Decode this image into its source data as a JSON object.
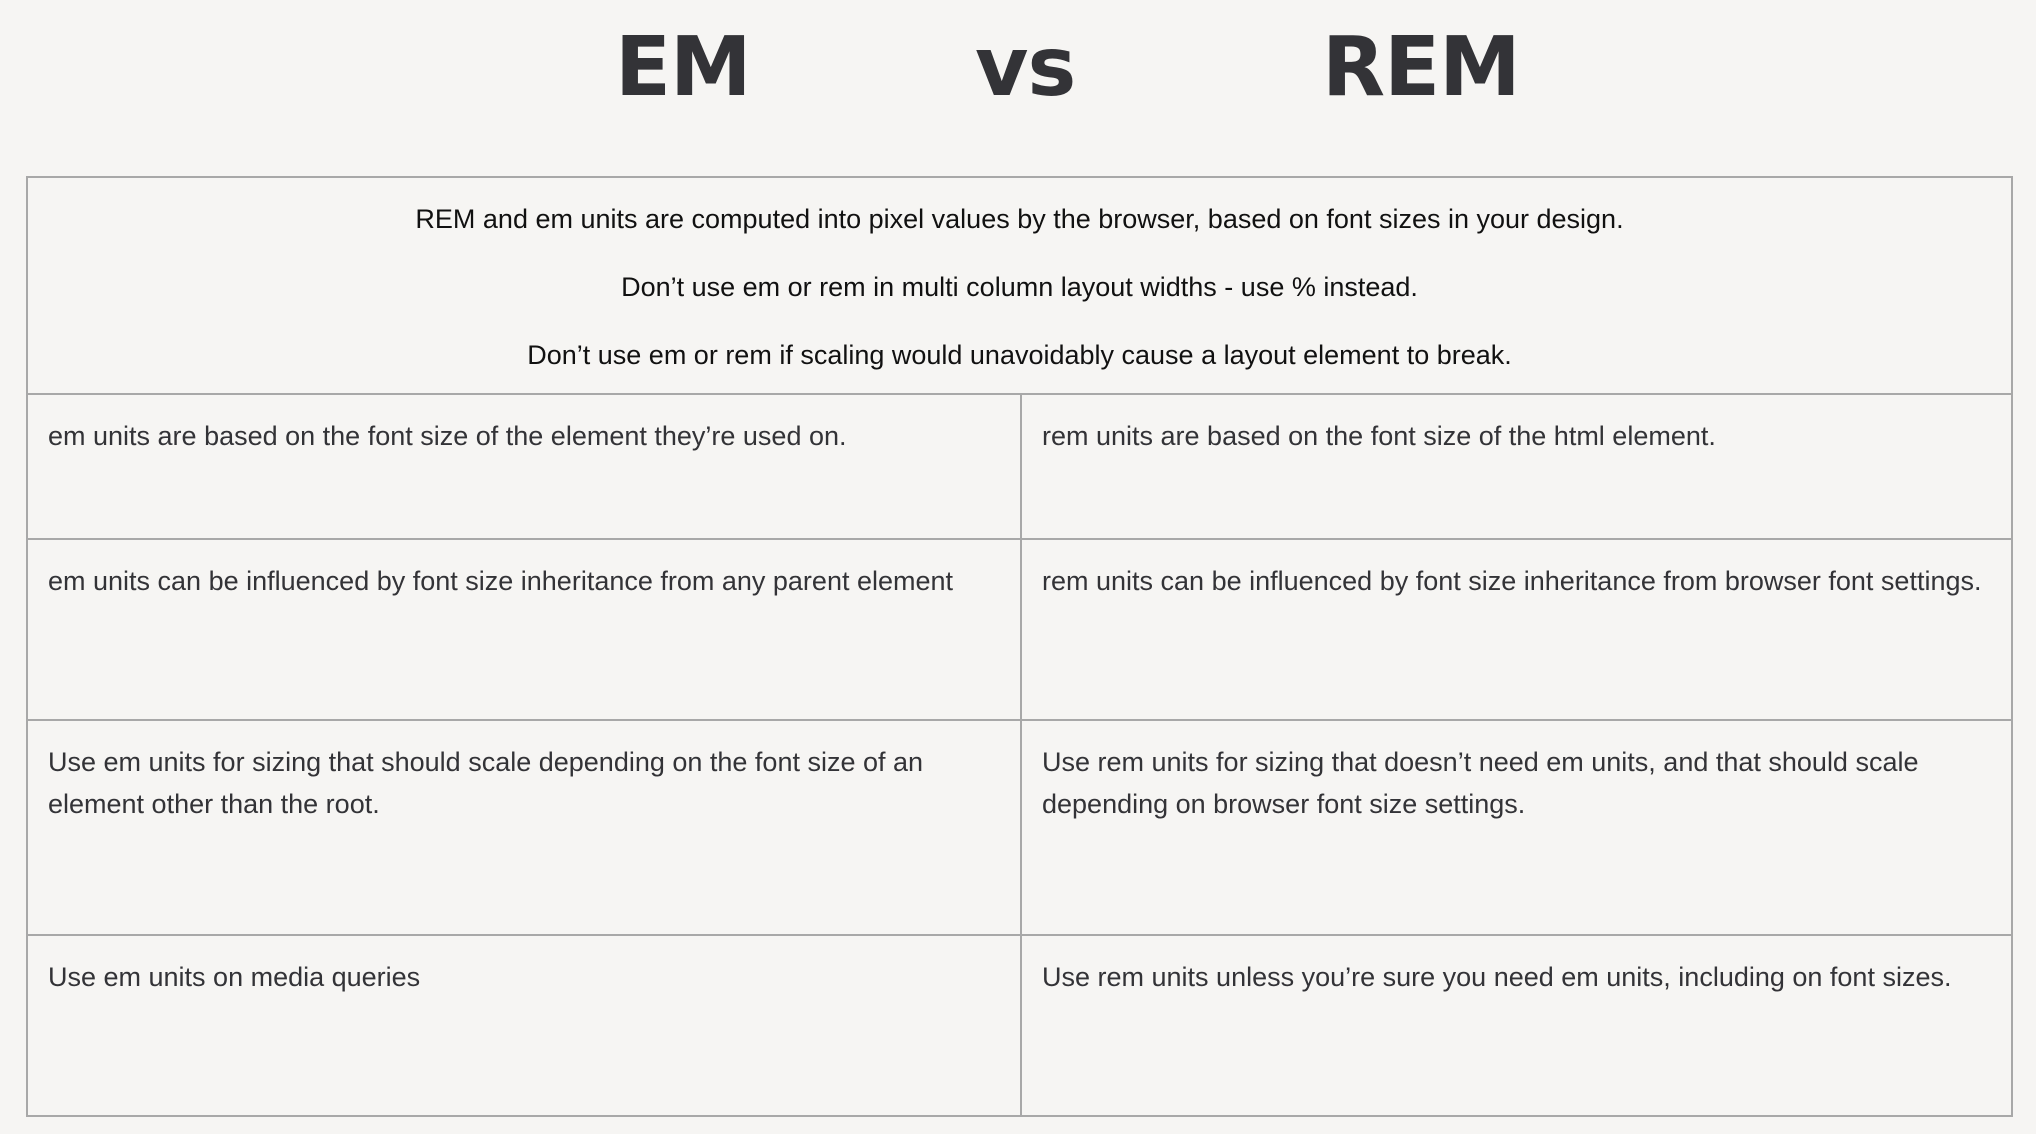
{
  "header": {
    "left_title": "EM",
    "middle_title": "vs",
    "right_title": "REM"
  },
  "intro": [
    "REM and em units are computed into pixel values by the browser, based on font sizes in your design.",
    "Don’t use em or rem in multi column layout widths - use % instead.",
    "Don’t use em or rem if scaling would unavoidably cause a layout element to break."
  ],
  "comparison": [
    {
      "em": "em units are based on the font size of the element they’re used on.",
      "rem": "rem units are based on the font size of the html element."
    },
    {
      "em": "em units can be influenced by font size inheritance from any parent element",
      "rem": "rem units can be influenced by font size inheritance from browser font settings."
    },
    {
      "em": "Use em units for sizing that should scale depending on the font size of an element other than the root.",
      "rem": "Use rem units for sizing that doesn’t need em units, and that should scale depending on browser font size settings."
    },
    {
      "em": "Use em units on media queries",
      "rem": "Use rem units unless you’re sure you need em units, including on font sizes."
    }
  ]
}
